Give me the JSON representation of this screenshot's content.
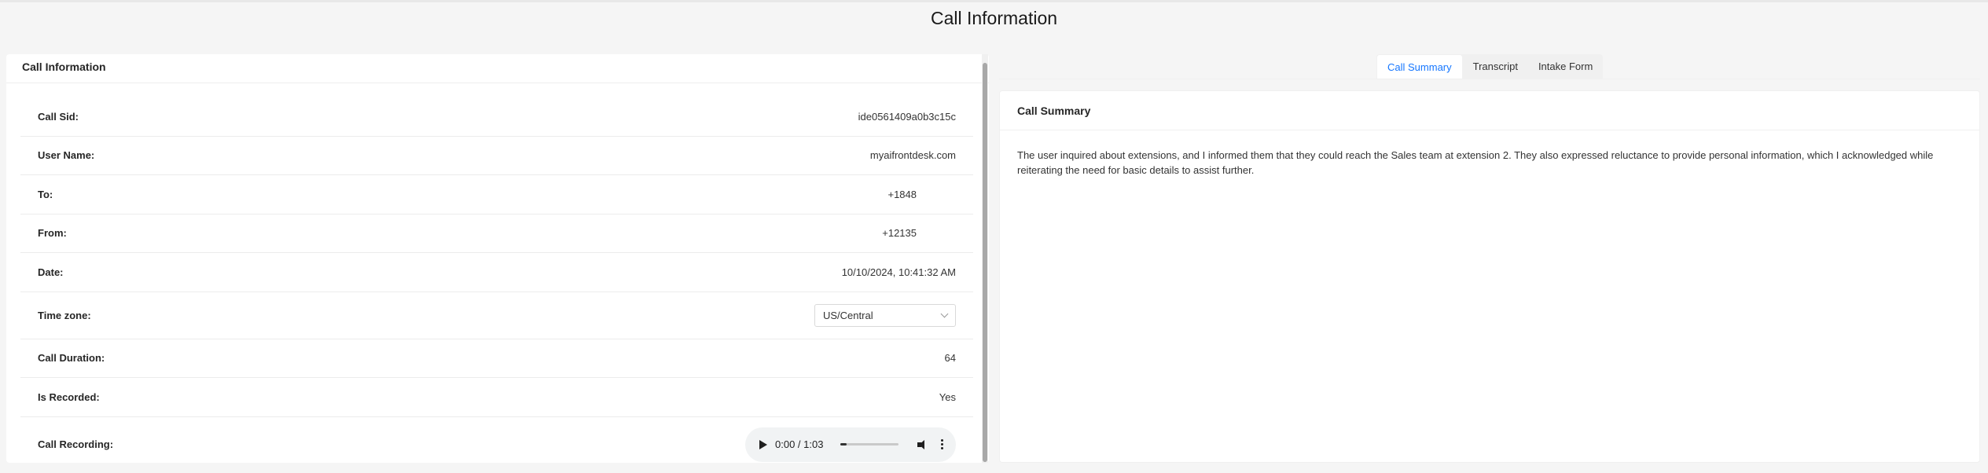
{
  "page": {
    "title": "Call Information"
  },
  "left": {
    "header": "Call Information",
    "rows": {
      "call_sid": {
        "label": "Call Sid:",
        "value": "ide0561409a0b3c15c"
      },
      "user_name": {
        "label": "User Name:",
        "value": "myaifrontdesk.com"
      },
      "to": {
        "label": "To:",
        "value": "+1848"
      },
      "from": {
        "label": "From:",
        "value": "+12135"
      },
      "date": {
        "label": "Date:",
        "value": "10/10/2024, 10:41:32 AM"
      },
      "timezone": {
        "label": "Time zone:",
        "value": "US/Central"
      },
      "duration": {
        "label": "Call Duration:",
        "value": "64"
      },
      "recorded": {
        "label": "Is Recorded:",
        "value": "Yes"
      },
      "recording": {
        "label": "Call Recording:",
        "time": "0:00 / 1:03",
        "progress": 0.0
      }
    }
  },
  "tabs": [
    {
      "label": "Call Summary",
      "active": true
    },
    {
      "label": "Transcript",
      "active": false
    },
    {
      "label": "Intake Form",
      "active": false
    }
  ],
  "summary": {
    "header": "Call Summary",
    "text": "The user inquired about extensions, and I informed them that they could reach the Sales team at extension 2. They also expressed reluctance to provide personal information, which I acknowledged while reiterating the need for basic details to assist further."
  },
  "colors": {
    "accent": "#1677ff"
  }
}
